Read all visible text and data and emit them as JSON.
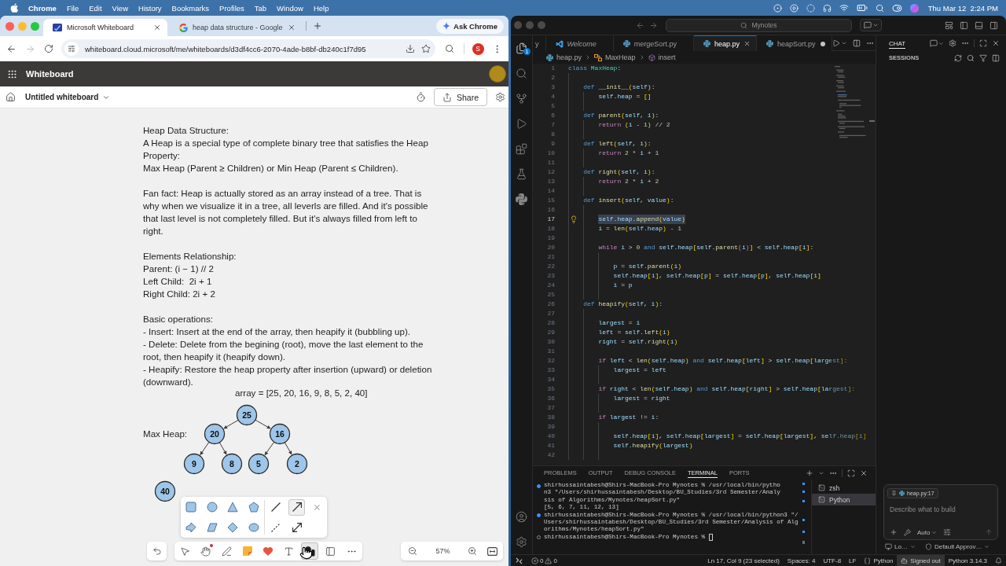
{
  "menu_bar": {
    "app": "Chrome",
    "menus": [
      "File",
      "Edit",
      "View",
      "History",
      "Bookmarks",
      "Profiles",
      "Tab",
      "Window",
      "Help"
    ],
    "clock": "Thu Mar 12  2:24 PM"
  },
  "browser": {
    "tabs": [
      {
        "title": "Microsoft Whiteboard",
        "selected": true
      },
      {
        "title": "heap data structure - Google",
        "selected": false
      }
    ],
    "ask_button": "Ask Chrome",
    "forward_disabled": true,
    "url": "whiteboard.cloud.microsoft/me/whiteboards/d3df4cc6-2070-4ade-b8bf-db240c1f7d95",
    "profile_initial": "S"
  },
  "whiteboard": {
    "app_title": "Whiteboard",
    "board_title": "Untitled whiteboard",
    "share_button": "Share",
    "notes": [
      [
        "Heap Data Structure:",
        "A Heap is a special type of complete binary tree that satisfies the Heap Property:",
        "Max Heap (Parent ≥ Children) or Min Heap (Parent ≤ Children)."
      ],
      [
        "Fan fact: Heap is actually stored as an array instead of a tree. That is why when we visualize it in a tree, all leverls are filled. And it's possible that last level is not completely filled. But it's always filled from left to right."
      ],
      [
        "Elements Relationship:",
        "Parent: (i − 1) // 2",
        "Left Child:  2i + 1",
        "Right Child: 2i + 2"
      ],
      [
        "Basic operations:",
        "- Insert: Insert at the end of the array, then heapify it (bubbling up).",
        "- Delete: Delete from the begining (root), move the last element to the root, then heapify it (heapify down).",
        "- Heapify: Restore the heap property after insertion (upward) or deletion (downward)."
      ]
    ],
    "array_label": "array = [25, 20, 16, 9, 8, 5, 2, 40]",
    "heap_label": "Max Heap:",
    "tree": {
      "value": "25",
      "children": [
        {
          "value": "20",
          "children": [
            {
              "value": "9"
            },
            {
              "value": "8"
            }
          ]
        },
        {
          "value": "16",
          "children": [
            {
              "value": "5"
            },
            {
              "value": "2"
            }
          ]
        }
      ]
    },
    "loose_node": {
      "value": "40"
    },
    "line_tools": [
      {
        "kind": "line",
        "selected": false
      },
      {
        "kind": "arrow",
        "selected": true
      },
      {
        "kind": "dashed",
        "selected": false
      },
      {
        "kind": "double-arrow",
        "selected": false
      }
    ],
    "tools": [
      {
        "kind": "select",
        "selected": false,
        "notification": false
      },
      {
        "kind": "hand",
        "selected": false,
        "notification": true
      },
      {
        "kind": "pen",
        "selected": false,
        "notification": false
      },
      {
        "kind": "note",
        "selected": false,
        "notification": false
      },
      {
        "kind": "reaction",
        "selected": false,
        "notification": false
      },
      {
        "kind": "text",
        "selected": false,
        "notification": false
      },
      {
        "kind": "shapes",
        "selected": true,
        "notification": false
      },
      {
        "kind": "template",
        "selected": false,
        "notification": false
      },
      {
        "kind": "more",
        "selected": false,
        "notification": false
      }
    ],
    "zoom": "57%"
  },
  "editor": {
    "command_center": "Mynotes",
    "explorer_badge": "1",
    "tabs": [
      {
        "title": "y",
        "kind": "plain",
        "selected": false,
        "preview": false,
        "dirty": false
      },
      {
        "title": "Welcome",
        "kind": "welcome",
        "selected": false,
        "preview": true,
        "dirty": false
      },
      {
        "title": "mergeSort.py",
        "kind": "python",
        "selected": false,
        "preview": false,
        "dirty": false
      },
      {
        "title": "heap.py",
        "kind": "python",
        "selected": true,
        "preview": false,
        "dirty": false
      },
      {
        "title": "heapSort.py",
        "kind": "python",
        "selected": false,
        "preview": false,
        "dirty": true
      }
    ],
    "breadcrumb": [
      "heap.py",
      "MaxHeap",
      "insert"
    ],
    "lines": [
      {
        "number": "1",
        "selected": false,
        "tokens": [
          {
            "kind": "kw",
            "text": "class "
          },
          {
            "kind": "cls",
            "text": "MaxHeap"
          },
          {
            "kind": "op",
            "text": ":"
          }
        ]
      },
      {
        "number": "2",
        "selected": false
      },
      {
        "number": "3",
        "selected": false,
        "tokens": [
          {
            "kind": "kw",
            "text": "    def "
          },
          {
            "kind": "fn",
            "text": "__init__"
          },
          {
            "kind": "b1",
            "text": "("
          },
          {
            "kind": "var",
            "text": "self"
          },
          {
            "kind": "b1",
            "text": ")"
          },
          {
            "kind": "op",
            "text": ":"
          }
        ]
      },
      {
        "number": "4",
        "selected": false,
        "tokens": [
          {
            "kind": "var",
            "text": "        self.heap"
          },
          {
            "kind": "op",
            "text": " = "
          },
          {
            "kind": "b1",
            "text": "[]"
          }
        ]
      },
      {
        "number": "5",
        "selected": false
      },
      {
        "number": "6",
        "selected": false,
        "tokens": [
          {
            "kind": "kw",
            "text": "    def "
          },
          {
            "kind": "fn",
            "text": "parent"
          },
          {
            "kind": "b1",
            "text": "("
          },
          {
            "kind": "var",
            "text": "self, i"
          },
          {
            "kind": "b1",
            "text": ")"
          },
          {
            "kind": "op",
            "text": ":"
          }
        ]
      },
      {
        "number": "7",
        "selected": false,
        "tokens": [
          {
            "kind": "ctl",
            "text": "        return "
          },
          {
            "kind": "b1",
            "text": "("
          },
          {
            "kind": "var",
            "text": "i"
          },
          {
            "kind": "op",
            "text": " - "
          },
          {
            "kind": "num",
            "text": "1"
          },
          {
            "kind": "b1",
            "text": ")"
          },
          {
            "kind": "op",
            "text": " // "
          },
          {
            "kind": "num",
            "text": "2"
          }
        ]
      },
      {
        "number": "8",
        "selected": false
      },
      {
        "number": "9",
        "selected": false,
        "tokens": [
          {
            "kind": "kw",
            "text": "    def "
          },
          {
            "kind": "fn",
            "text": "left"
          },
          {
            "kind": "b1",
            "text": "("
          },
          {
            "kind": "var",
            "text": "self, i"
          },
          {
            "kind": "b1",
            "text": ")"
          },
          {
            "kind": "op",
            "text": ":"
          }
        ]
      },
      {
        "number": "10",
        "selected": false,
        "tokens": [
          {
            "kind": "ctl",
            "text": "        return "
          },
          {
            "kind": "num",
            "text": "2"
          },
          {
            "kind": "op",
            "text": " * "
          },
          {
            "kind": "var",
            "text": "i"
          },
          {
            "kind": "op",
            "text": " + "
          },
          {
            "kind": "num",
            "text": "1"
          }
        ]
      },
      {
        "number": "11",
        "selected": false
      },
      {
        "number": "12",
        "selected": false,
        "tokens": [
          {
            "kind": "kw",
            "text": "    def "
          },
          {
            "kind": "fn",
            "text": "right"
          },
          {
            "kind": "b1",
            "text": "("
          },
          {
            "kind": "var",
            "text": "self, i"
          },
          {
            "kind": "b1",
            "text": ")"
          },
          {
            "kind": "op",
            "text": ":"
          }
        ]
      },
      {
        "number": "13",
        "selected": false,
        "tokens": [
          {
            "kind": "ctl",
            "text": "        return "
          },
          {
            "kind": "num",
            "text": "2"
          },
          {
            "kind": "op",
            "text": " * "
          },
          {
            "kind": "var",
            "text": "i"
          },
          {
            "kind": "op",
            "text": " + "
          },
          {
            "kind": "num",
            "text": "2"
          }
        ]
      },
      {
        "number": "14",
        "selected": false
      },
      {
        "number": "15",
        "selected": false,
        "tokens": [
          {
            "kind": "kw",
            "text": "    def "
          },
          {
            "kind": "fn",
            "text": "insert"
          },
          {
            "kind": "b1",
            "text": "("
          },
          {
            "kind": "var",
            "text": "self, value"
          },
          {
            "kind": "b1",
            "text": ")"
          },
          {
            "kind": "op",
            "text": ":"
          }
        ]
      },
      {
        "number": "16",
        "selected": false
      },
      {
        "number": "17",
        "selected": true,
        "tokens": [
          {
            "kind": "var",
            "text": "        self.heap."
          },
          {
            "kind": "fn",
            "text": "append"
          },
          {
            "kind": "b1",
            "text": "("
          },
          {
            "kind": "var",
            "text": "value"
          },
          {
            "kind": "b1",
            "text": ")"
          }
        ]
      },
      {
        "number": "18",
        "selected": false,
        "tokens": [
          {
            "kind": "var",
            "text": "        i"
          },
          {
            "kind": "op",
            "text": " = "
          },
          {
            "kind": "fn",
            "text": "len"
          },
          {
            "kind": "b1",
            "text": "("
          },
          {
            "kind": "var",
            "text": "self.heap"
          },
          {
            "kind": "b1",
            "text": ")"
          },
          {
            "kind": "op",
            "text": " - "
          },
          {
            "kind": "num",
            "text": "1"
          }
        ]
      },
      {
        "number": "19",
        "selected": false
      },
      {
        "number": "20",
        "selected": false,
        "tokens": [
          {
            "kind": "ctl",
            "text": "        while "
          },
          {
            "kind": "var",
            "text": "i"
          },
          {
            "kind": "op",
            "text": " > "
          },
          {
            "kind": "num",
            "text": "0"
          },
          {
            "kind": "kw",
            "text": " and "
          },
          {
            "kind": "var",
            "text": "self.heap"
          },
          {
            "kind": "b1",
            "text": "["
          },
          {
            "kind": "var",
            "text": "self."
          },
          {
            "kind": "fn",
            "text": "parent"
          },
          {
            "kind": "b2",
            "text": "("
          },
          {
            "kind": "var",
            "text": "i"
          },
          {
            "kind": "b2",
            "text": ")"
          },
          {
            "kind": "b1",
            "text": "]"
          },
          {
            "kind": "op",
            "text": " < "
          },
          {
            "kind": "var",
            "text": "self.heap"
          },
          {
            "kind": "b1",
            "text": "["
          },
          {
            "kind": "var",
            "text": "i"
          },
          {
            "kind": "b1",
            "text": "]"
          },
          {
            "kind": "op",
            "text": ":"
          }
        ]
      },
      {
        "number": "21",
        "selected": false
      },
      {
        "number": "22",
        "selected": false,
        "tokens": [
          {
            "kind": "var",
            "text": "            p"
          },
          {
            "kind": "op",
            "text": " = "
          },
          {
            "kind": "var",
            "text": "self."
          },
          {
            "kind": "fn",
            "text": "parent"
          },
          {
            "kind": "b1",
            "text": "("
          },
          {
            "kind": "var",
            "text": "i"
          },
          {
            "kind": "b1",
            "text": ")"
          }
        ]
      },
      {
        "number": "23",
        "selected": false,
        "tokens": [
          {
            "kind": "var",
            "text": "            self.heap"
          },
          {
            "kind": "b1",
            "text": "["
          },
          {
            "kind": "var",
            "text": "i"
          },
          {
            "kind": "b1",
            "text": "]"
          },
          {
            "kind": "op",
            "text": ", "
          },
          {
            "kind": "var",
            "text": "self.heap"
          },
          {
            "kind": "b1",
            "text": "["
          },
          {
            "kind": "var",
            "text": "p"
          },
          {
            "kind": "b1",
            "text": "]"
          },
          {
            "kind": "op",
            "text": " = "
          },
          {
            "kind": "var",
            "text": "self.heap"
          },
          {
            "kind": "b1",
            "text": "["
          },
          {
            "kind": "var",
            "text": "p"
          },
          {
            "kind": "b1",
            "text": "]"
          },
          {
            "kind": "op",
            "text": ", "
          },
          {
            "kind": "var",
            "text": "self.heap"
          },
          {
            "kind": "b1",
            "text": "["
          },
          {
            "kind": "var",
            "text": "i"
          },
          {
            "kind": "b1",
            "text": "]"
          }
        ]
      },
      {
        "number": "24",
        "selected": false,
        "tokens": [
          {
            "kind": "var",
            "text": "            i"
          },
          {
            "kind": "op",
            "text": " = "
          },
          {
            "kind": "var",
            "text": "p"
          }
        ]
      },
      {
        "number": "25",
        "selected": false
      },
      {
        "number": "26",
        "selected": false,
        "tokens": [
          {
            "kind": "kw",
            "text": "    def "
          },
          {
            "kind": "fn",
            "text": "heapify"
          },
          {
            "kind": "b1",
            "text": "("
          },
          {
            "kind": "var",
            "text": "self, i"
          },
          {
            "kind": "b1",
            "text": ")"
          },
          {
            "kind": "op",
            "text": ":"
          }
        ]
      },
      {
        "number": "27",
        "selected": false
      },
      {
        "number": "28",
        "selected": false,
        "tokens": [
          {
            "kind": "var",
            "text": "        largest"
          },
          {
            "kind": "op",
            "text": " = "
          },
          {
            "kind": "var",
            "text": "i"
          }
        ]
      },
      {
        "number": "29",
        "selected": false,
        "tokens": [
          {
            "kind": "var",
            "text": "        left"
          },
          {
            "kind": "op",
            "text": " = "
          },
          {
            "kind": "var",
            "text": "self."
          },
          {
            "kind": "fn",
            "text": "left"
          },
          {
            "kind": "b1",
            "text": "("
          },
          {
            "kind": "var",
            "text": "i"
          },
          {
            "kind": "b1",
            "text": ")"
          }
        ]
      },
      {
        "number": "30",
        "selected": false,
        "tokens": [
          {
            "kind": "var",
            "text": "        right"
          },
          {
            "kind": "op",
            "text": " = "
          },
          {
            "kind": "var",
            "text": "self."
          },
          {
            "kind": "fn",
            "text": "right"
          },
          {
            "kind": "b1",
            "text": "("
          },
          {
            "kind": "var",
            "text": "i"
          },
          {
            "kind": "b1",
            "text": ")"
          }
        ]
      },
      {
        "number": "31",
        "selected": false
      },
      {
        "number": "32",
        "selected": false,
        "tokens": [
          {
            "kind": "ctl",
            "text": "        if "
          },
          {
            "kind": "var",
            "text": "left"
          },
          {
            "kind": "op",
            "text": " < "
          },
          {
            "kind": "fn",
            "text": "len"
          },
          {
            "kind": "b1",
            "text": "("
          },
          {
            "kind": "var",
            "text": "self.heap"
          },
          {
            "kind": "b1",
            "text": ")"
          },
          {
            "kind": "kw",
            "text": " and "
          },
          {
            "kind": "var",
            "text": "self.heap"
          },
          {
            "kind": "b1",
            "text": "["
          },
          {
            "kind": "var",
            "text": "left"
          },
          {
            "kind": "b1",
            "text": "]"
          },
          {
            "kind": "op",
            "text": " > "
          },
          {
            "kind": "var",
            "text": "self.heap"
          },
          {
            "kind": "b1",
            "text": "["
          },
          {
            "kind": "var",
            "text": "largest"
          },
          {
            "kind": "b1",
            "text": "]"
          },
          {
            "kind": "op",
            "text": ":"
          }
        ]
      },
      {
        "number": "33",
        "selected": false,
        "tokens": [
          {
            "kind": "var",
            "text": "            largest"
          },
          {
            "kind": "op",
            "text": " = "
          },
          {
            "kind": "var",
            "text": "left"
          }
        ]
      },
      {
        "number": "34",
        "selected": false
      },
      {
        "number": "35",
        "selected": false,
        "tokens": [
          {
            "kind": "ctl",
            "text": "        if "
          },
          {
            "kind": "var",
            "text": "right"
          },
          {
            "kind": "op",
            "text": " < "
          },
          {
            "kind": "fn",
            "text": "len"
          },
          {
            "kind": "b1",
            "text": "("
          },
          {
            "kind": "var",
            "text": "self.heap"
          },
          {
            "kind": "b1",
            "text": ")"
          },
          {
            "kind": "kw",
            "text": " and "
          },
          {
            "kind": "var",
            "text": "self.heap"
          },
          {
            "kind": "b1",
            "text": "["
          },
          {
            "kind": "var",
            "text": "right"
          },
          {
            "kind": "b1",
            "text": "]"
          },
          {
            "kind": "op",
            "text": " > "
          },
          {
            "kind": "var",
            "text": "self.heap"
          },
          {
            "kind": "b1",
            "text": "["
          },
          {
            "kind": "var",
            "text": "largest"
          },
          {
            "kind": "b1",
            "text": "]"
          },
          {
            "kind": "op",
            "text": ":"
          }
        ]
      },
      {
        "number": "36",
        "selected": false,
        "tokens": [
          {
            "kind": "var",
            "text": "            largest"
          },
          {
            "kind": "op",
            "text": " = "
          },
          {
            "kind": "var",
            "text": "right"
          }
        ]
      },
      {
        "number": "37",
        "selected": false
      },
      {
        "number": "38",
        "selected": false,
        "tokens": [
          {
            "kind": "ctl",
            "text": "        if "
          },
          {
            "kind": "var",
            "text": "largest"
          },
          {
            "kind": "op",
            "text": " != "
          },
          {
            "kind": "var",
            "text": "i"
          },
          {
            "kind": "op",
            "text": ":"
          }
        ]
      },
      {
        "number": "39",
        "selected": false
      },
      {
        "number": "40",
        "selected": false,
        "tokens": [
          {
            "kind": "var",
            "text": "            self.heap"
          },
          {
            "kind": "b1",
            "text": "["
          },
          {
            "kind": "var",
            "text": "i"
          },
          {
            "kind": "b1",
            "text": "]"
          },
          {
            "kind": "op",
            "text": ", "
          },
          {
            "kind": "var",
            "text": "self.heap"
          },
          {
            "kind": "b1",
            "text": "["
          },
          {
            "kind": "var",
            "text": "largest"
          },
          {
            "kind": "b1",
            "text": "]"
          },
          {
            "kind": "op",
            "text": " = "
          },
          {
            "kind": "var",
            "text": "self.heap"
          },
          {
            "kind": "b1",
            "text": "["
          },
          {
            "kind": "var",
            "text": "largest"
          },
          {
            "kind": "b1",
            "text": "]"
          },
          {
            "kind": "op",
            "text": ", "
          },
          {
            "kind": "var",
            "text": "self.heap"
          },
          {
            "kind": "b1",
            "text": "["
          },
          {
            "kind": "var",
            "text": "i"
          },
          {
            "kind": "b1",
            "text": "]"
          }
        ]
      },
      {
        "number": "41",
        "selected": false,
        "tokens": [
          {
            "kind": "var",
            "text": "            self."
          },
          {
            "kind": "fn",
            "text": "heapify"
          },
          {
            "kind": "b1",
            "text": "("
          },
          {
            "kind": "var",
            "text": "largest"
          },
          {
            "kind": "b1",
            "text": ")"
          }
        ]
      },
      {
        "number": "42",
        "selected": false
      }
    ],
    "panel": {
      "tabs": [
        {
          "label": "PROBLEMS",
          "selected": false
        },
        {
          "label": "OUTPUT",
          "selected": false
        },
        {
          "label": "DEBUG CONSOLE",
          "selected": false
        },
        {
          "label": "TERMINAL",
          "selected": true
        },
        {
          "label": "PORTS",
          "selected": false
        }
      ],
      "terminal": [
        {
          "succeeded": true,
          "lines": [
            "shirhussaintabesh@Shirs-MacBook-Pro Mynotes % /usr/local/bin/pytho",
            "n3 \"/Users/shirhussaintabesh/Desktop/BU_Studies/3rd Semester/Analy",
            "sis of Algorithms/Mynotes/heapSort.py\"",
            "[5, 6, 7, 11, 12, 13]"
          ]
        },
        {
          "succeeded": true,
          "lines": [
            "shirhussaintabesh@Shirs-MacBook-Pro Mynotes % /usr/local/bin/python3 \"/",
            "Users/shirhussaintabesh/Desktop/BU_Studies/3rd Semester/Analysis of Alg",
            "orithms/Mynotes/heapSort.py\""
          ]
        },
        {
          "succeeded": false,
          "lines": [
            "shirhussaintabesh@Shirs-MacBook-Pro Mynotes % "
          ]
        }
      ],
      "sessions": [
        {
          "name": "zsh",
          "selected": false
        },
        {
          "name": "Python",
          "selected": true
        }
      ]
    },
    "chat": {
      "tab": "CHAT",
      "sessions_heading": "SESSIONS",
      "context_chip": "heap.py:17",
      "placeholder": "Describe what to build",
      "mode": "Auto",
      "location": "Lo…",
      "approvals": "Default Approv…"
    },
    "status_bar": {
      "errors": "0",
      "warnings": "0",
      "items": [
        {
          "text": "Ln 17, Col 9 (23 selected)",
          "kind": "plain"
        },
        {
          "text": "Spaces: 4",
          "kind": "plain"
        },
        {
          "text": "UTF-8",
          "kind": "plain"
        },
        {
          "text": "LF",
          "kind": "plain"
        },
        {
          "text": "Python",
          "kind": "language"
        },
        {
          "text": "Signed out",
          "kind": "account"
        },
        {
          "text": "Python 3.14.3",
          "kind": "plain"
        }
      ]
    }
  }
}
